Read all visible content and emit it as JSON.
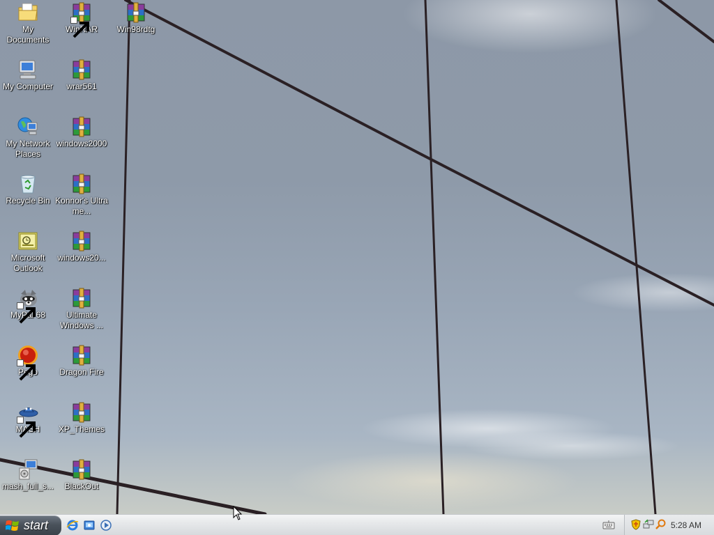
{
  "desktop": {
    "icons": [
      {
        "label": "My Documents",
        "icon": "my-documents-icon"
      },
      {
        "label": "My Computer",
        "icon": "my-computer-icon"
      },
      {
        "label": "My Network Places",
        "icon": "network-places-icon"
      },
      {
        "label": "Recycle Bin",
        "icon": "recycle-bin-icon"
      },
      {
        "label": "Microsoft Outlook",
        "icon": "outlook-icon"
      },
      {
        "label": "MyPal 68",
        "icon": "mypal-icon"
      },
      {
        "label": "Pego",
        "icon": "pego-icon"
      },
      {
        "label": "MASH",
        "icon": "mash-icon"
      },
      {
        "label": "mash_full_s...",
        "icon": "installer-icon"
      },
      {
        "label": "WinRAR",
        "icon": "winrar-icon"
      },
      {
        "label": "wrar561",
        "icon": "winrar-archive-icon"
      },
      {
        "label": "windows2000",
        "icon": "winrar-archive-icon"
      },
      {
        "label": "Konnor's Ultra me...",
        "icon": "winrar-archive-icon"
      },
      {
        "label": "windows20...",
        "icon": "winrar-archive-icon"
      },
      {
        "label": "Ultimate Windows ...",
        "icon": "winrar-archive-icon"
      },
      {
        "label": "Dragon Fire",
        "icon": "winrar-archive-icon"
      },
      {
        "label": "XP_Themes",
        "icon": "winrar-archive-icon"
      },
      {
        "label": "BlackOut",
        "icon": "winrar-archive-icon"
      },
      {
        "label": "Win98rdtg",
        "icon": "winrar-archive-icon"
      }
    ]
  },
  "taskbar": {
    "start_label": "start",
    "quick_launch": [
      "internet-explorer-icon",
      "show-desktop-icon",
      "media-player-icon"
    ],
    "tray_icons": [
      "keyboard-icon",
      "security-shield-icon",
      "network-icon",
      "search-icon"
    ],
    "clock": "5:28 AM"
  },
  "colors": {
    "taskbar": "#dfe1e3",
    "start_button": "#4a525b",
    "desktop_sky": "#8d98a7"
  }
}
